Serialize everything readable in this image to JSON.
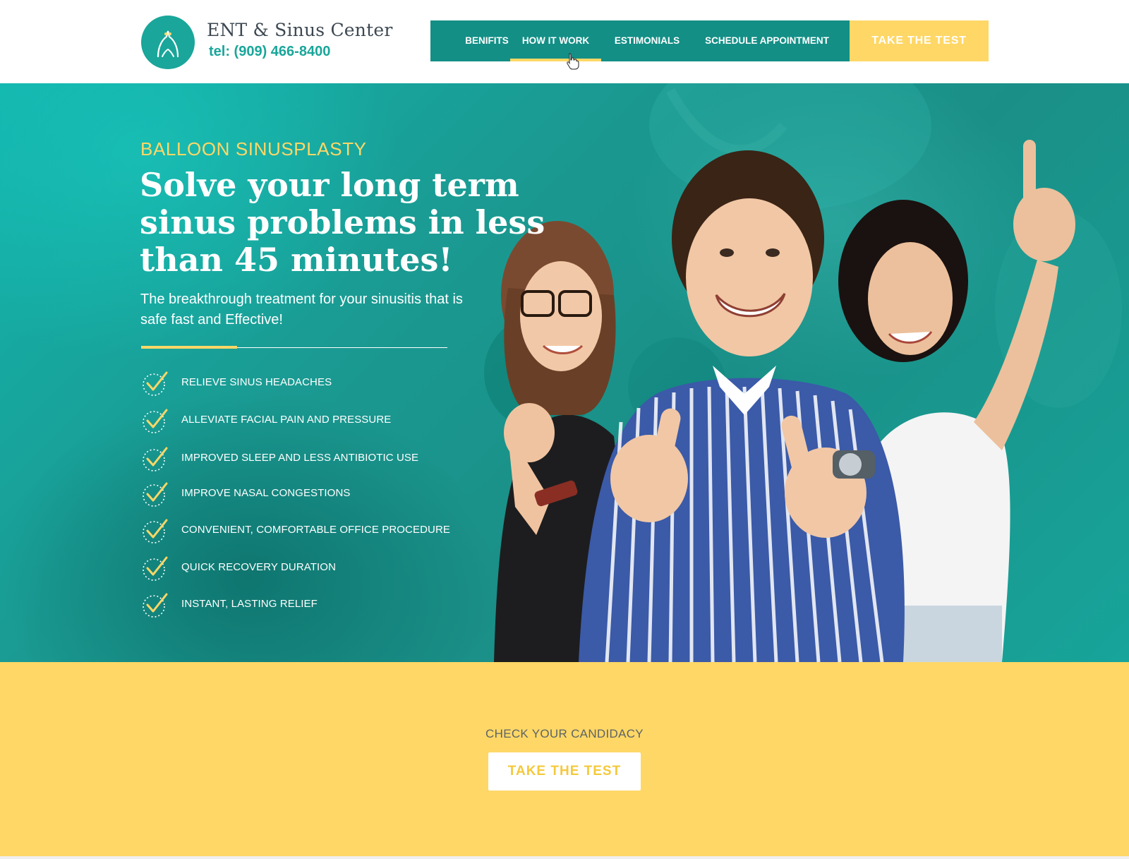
{
  "header": {
    "brand_name": "ENT & Sinus Center",
    "phone": "tel: (909) 466-8400",
    "logo_icon": "nose-outline-icon"
  },
  "nav": {
    "items": [
      {
        "label": "BENIFITS",
        "active": false
      },
      {
        "label": "HOW IT WORK",
        "active": true
      },
      {
        "label": "ESTIMONIALS",
        "active": false
      },
      {
        "label": "SCHEDULE APPOINTMENT",
        "active": false
      }
    ],
    "cta_label": "TAKE THE TEST"
  },
  "hero": {
    "eyebrow": "BALLOON SINUSPLASTY",
    "headline": "Solve your long term sinus problems in less than 45 minutes!",
    "subtext": "The breakthrough treatment for your sinusitis that is safe fast and Effective!",
    "benefits": [
      "RELIEVE SINUS HEADACHES",
      "ALLEVIATE FACIAL PAIN AND PRESSURE",
      "IMPROVED SLEEP AND LESS ANTIBIOTIC USE",
      "IMPROVE NASAL CONGESTIONS",
      "CONVENIENT, COMFORTABLE OFFICE PROCEDURE",
      "QUICK RECOVERY DURATION",
      "INSTANT, LASTING RELIEF"
    ],
    "benefit_icon": "check-circle-icon"
  },
  "candidacy": {
    "label": "CHECK YOUR CANDIDACY",
    "button_label": "TAKE THE TEST"
  },
  "colors": {
    "teal": "#1aa69a",
    "nav_teal": "#138f86",
    "yellow": "#fed766",
    "heading_gray": "#3d4852"
  }
}
